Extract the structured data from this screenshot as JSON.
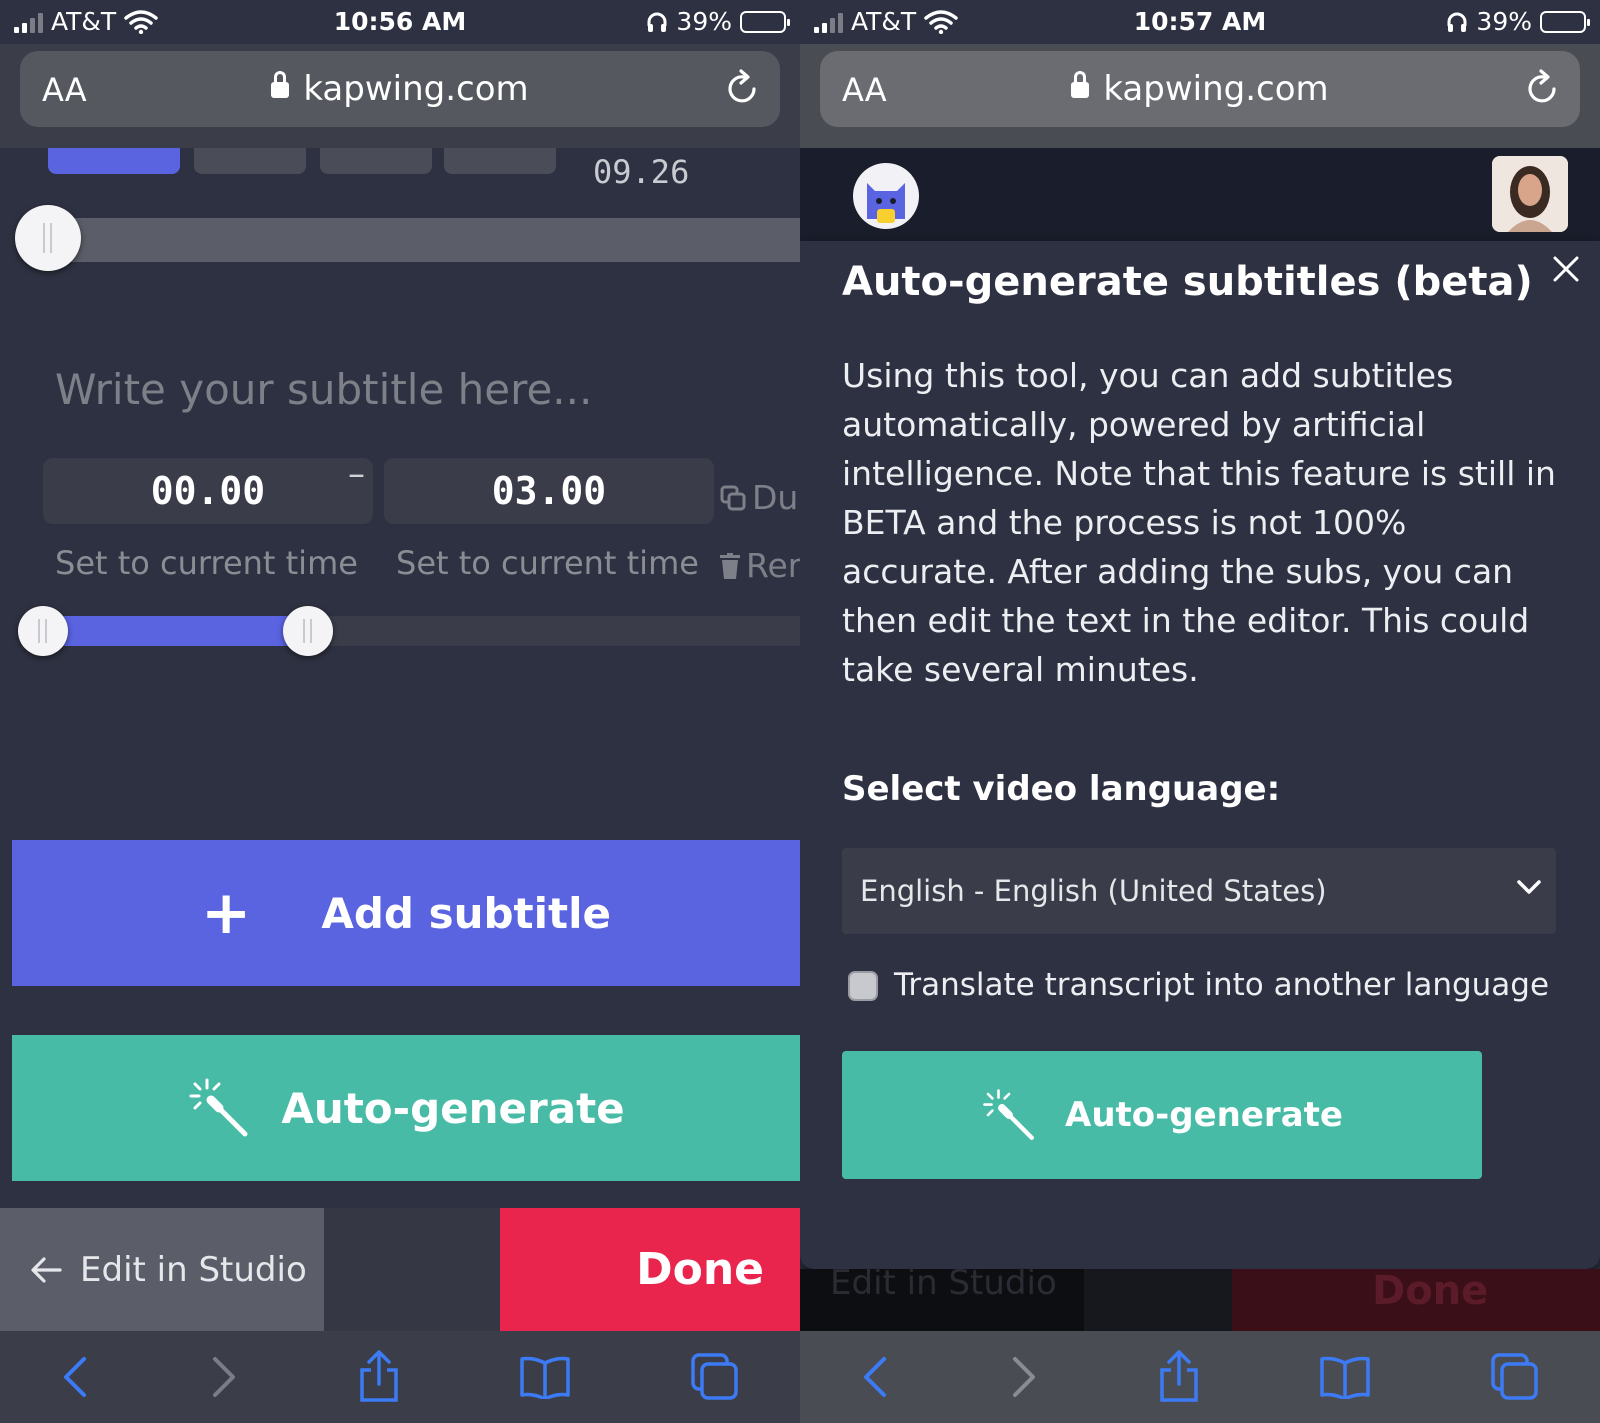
{
  "left": {
    "status": {
      "carrier": "AT&T",
      "time": "10:56 AM",
      "battery": "39%"
    },
    "url": {
      "aa": "AA",
      "domain": "kapwing.com"
    },
    "time_total": "09.26",
    "subtitle_placeholder": "Write your subtitle here...",
    "start_time": "00.00",
    "end_time": "03.00",
    "dash": "–",
    "duplicate": "Du",
    "remove": "Rer",
    "set_current_start": "Set to current time",
    "set_current_end": "Set to current time",
    "add_subtitle": "Add subtitle",
    "auto_generate": "Auto-generate",
    "edit_in_studio": "Edit in Studio",
    "done": "Done"
  },
  "right": {
    "status": {
      "carrier": "AT&T",
      "time": "10:57 AM",
      "battery": "39%"
    },
    "url": {
      "aa": "AA",
      "domain": "kapwing.com"
    },
    "modal": {
      "title": "Auto-generate subtitles (beta)",
      "description": "Using this tool, you can add subtitles automatically, powered by artificial intelligence. Note that this feature is still in BETA and the process is not 100% accurate. After adding the subs, you can then edit the text in the editor. This could take several minutes.",
      "language_label": "Select video language:",
      "language_value": "English - English (United States)",
      "translate_label": "Translate transcript into another language",
      "auto_generate": "Auto-generate"
    },
    "ghost_edit": "Edit in Studio",
    "ghost_done": "Done"
  },
  "colors": {
    "accent_blue": "#5a63e0",
    "accent_teal": "#48bba6",
    "done_red": "#e9244d",
    "safari_blue": "#3d7bf6"
  },
  "battery_level": 0.39,
  "icons": [
    "lock-icon",
    "reload-icon",
    "wifi-icon",
    "headphones-icon",
    "battery-icon",
    "plus-icon",
    "magic-wand-icon",
    "arrow-left-icon",
    "back-icon",
    "forward-icon",
    "share-icon",
    "bookmarks-icon",
    "tabs-icon",
    "close-icon",
    "chevron-down-icon",
    "copy-icon",
    "trash-icon"
  ]
}
